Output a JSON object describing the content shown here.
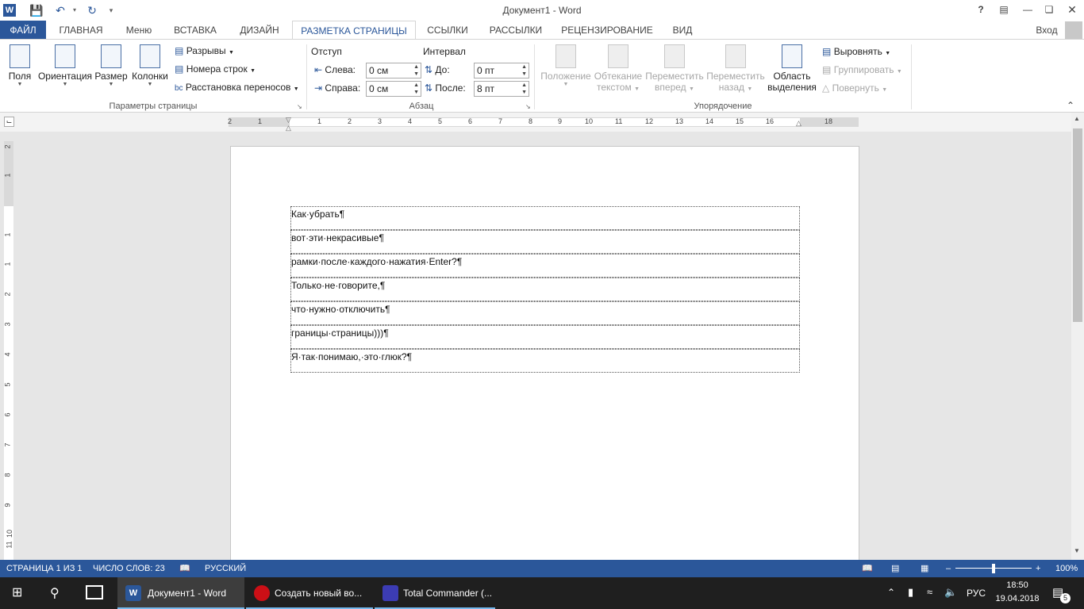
{
  "window": {
    "title": "Документ1 - Word",
    "help": "?",
    "sign_in": "Вход"
  },
  "tabs": [
    "ФАЙЛ",
    "ГЛАВНАЯ",
    "Меню",
    "ВСТАВКА",
    "ДИЗАЙН",
    "РАЗМЕТКА СТРАНИЦЫ",
    "ССЫЛКИ",
    "РАССЫЛКИ",
    "РЕЦЕНЗИРОВАНИЕ",
    "ВИД"
  ],
  "ribbon": {
    "page_setup": {
      "fields": "Поля",
      "orientation": "Ориентация",
      "size": "Размер",
      "columns": "Колонки",
      "breaks": "Разрывы",
      "line_numbers": "Номера строк",
      "hyphenation": "Расстановка переносов",
      "label": "Параметры страницы"
    },
    "paragraph": {
      "indent_title": "Отступ",
      "spacing_title": "Интервал",
      "left_label": "Слева:",
      "left_value": "0 см",
      "right_label": "Справа:",
      "right_value": "0 см",
      "before_label": "До:",
      "before_value": "0 пт",
      "after_label": "После:",
      "after_value": "8 пт",
      "label": "Абзац"
    },
    "arrange": {
      "position": "Положение",
      "wrap_1": "Обтекание",
      "wrap_2": "текстом",
      "forward_1": "Переместить",
      "forward_2": "вперед",
      "backward_1": "Переместить",
      "backward_2": "назад",
      "selection_1": "Область",
      "selection_2": "выделения",
      "align": "Выровнять",
      "group": "Группировать",
      "rotate": "Повернуть",
      "label": "Упорядочение"
    }
  },
  "ruler": {
    "h_numbers": [
      "2",
      "1",
      "1",
      "2",
      "3",
      "4",
      "5",
      "6",
      "7",
      "8",
      "9",
      "10",
      "11",
      "12",
      "13",
      "14",
      "15",
      "16",
      "18"
    ],
    "v_numbers": [
      "2",
      "1",
      "1",
      "1",
      "2",
      "3",
      "4",
      "5",
      "6",
      "7",
      "8",
      "9",
      "10",
      "11"
    ]
  },
  "document": {
    "paragraphs": [
      "Как·убрать¶",
      "вот·эти·некрасивые¶",
      "рамки·после·каждого·нажатия·Enter?¶",
      "Только·не·говорите,¶",
      "что·нужно·отключить¶",
      "границы·страницы)))¶",
      "Я·так·понимаю,·это·глюк?¶"
    ]
  },
  "status": {
    "page": "СТРАНИЦА 1 ИЗ 1",
    "words": "ЧИСЛО СЛОВ: 23",
    "language": "РУССКИЙ",
    "zoom": "100%"
  },
  "taskbar": {
    "apps": [
      "Документ1 - Word",
      "Создать новый во...",
      "Total Commander (..."
    ],
    "lang": "РУС",
    "time": "18:50",
    "date": "19.04.2018",
    "notifications": "5"
  },
  "colors": {
    "accent": "#2b579a",
    "taskbar": "#1f1f1f"
  }
}
